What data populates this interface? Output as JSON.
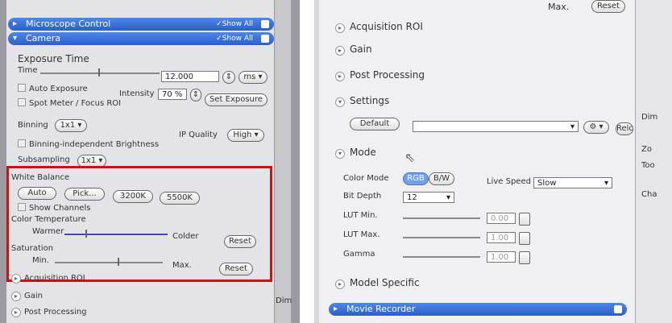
{
  "left": {
    "microscope_header": "Microscope Control",
    "microscope_show_all": "✓Show All",
    "camera_header": "Camera",
    "camera_show_all": "✓Show All",
    "exposure_title": "Exposure Time",
    "time_label": "Time",
    "time_value": "12.000",
    "time_unit": "ms",
    "auto_exposure": "Auto Exposure",
    "intensity_label": "Intensity",
    "intensity_value": "70 %",
    "set_exposure": "Set Exposure",
    "spot_meter": "Spot Meter / Focus ROI",
    "binning_label": "Binning",
    "binning_value": "1x1",
    "ip_quality_label": "IP Quality",
    "ip_quality_value": "High",
    "binning_independent": "Binning-independent Brightness",
    "subsampling_label": "Subsampling",
    "subsampling_value": "1x1",
    "white_balance": "White Balance",
    "wb_auto": "Auto",
    "wb_pick": "Pick...",
    "wb_3200": "3200K",
    "wb_5500": "5500K",
    "show_channels": "Show Channels",
    "color_temp": "Color Temperature",
    "warmer": "Warmer",
    "colder": "Colder",
    "reset1": "Reset",
    "saturation": "Saturation",
    "min": "Min.",
    "max": "Max.",
    "reset2": "Reset",
    "acq_roi": "Acquisition ROI",
    "gain": "Gain",
    "post_processing": "Post Processing",
    "side_label": "Dim"
  },
  "right": {
    "top_max": "Max.",
    "top_reset": "Reset",
    "acq_roi": "Acquisition ROI",
    "gain": "Gain",
    "post_processing": "Post Processing",
    "settings": "Settings",
    "default_btn": "Default",
    "reload_btn": "Reload",
    "mode": "Mode",
    "color_mode_label": "Color Mode",
    "rgb": "RGB",
    "bw": "B/W",
    "live_speed_label": "Live Speed",
    "live_speed_value": "Slow",
    "bit_depth_label": "Bit Depth",
    "bit_depth_value": "12",
    "lut_min": "LUT Min.",
    "lut_min_value": "0.00",
    "lut_max": "LUT Max.",
    "lut_max_value": "1.00",
    "gamma": "Gamma",
    "gamma_value": "1.00",
    "model_specific": "Model Specific",
    "movie_recorder": "Movie Recorder",
    "side_labels": [
      "Dim",
      "Zo",
      "Too",
      "Cha"
    ]
  },
  "colors": {
    "header_blue": "#2c5fc9",
    "highlight_red": "#cc1111",
    "rgb_active": "#6fa0e8"
  }
}
